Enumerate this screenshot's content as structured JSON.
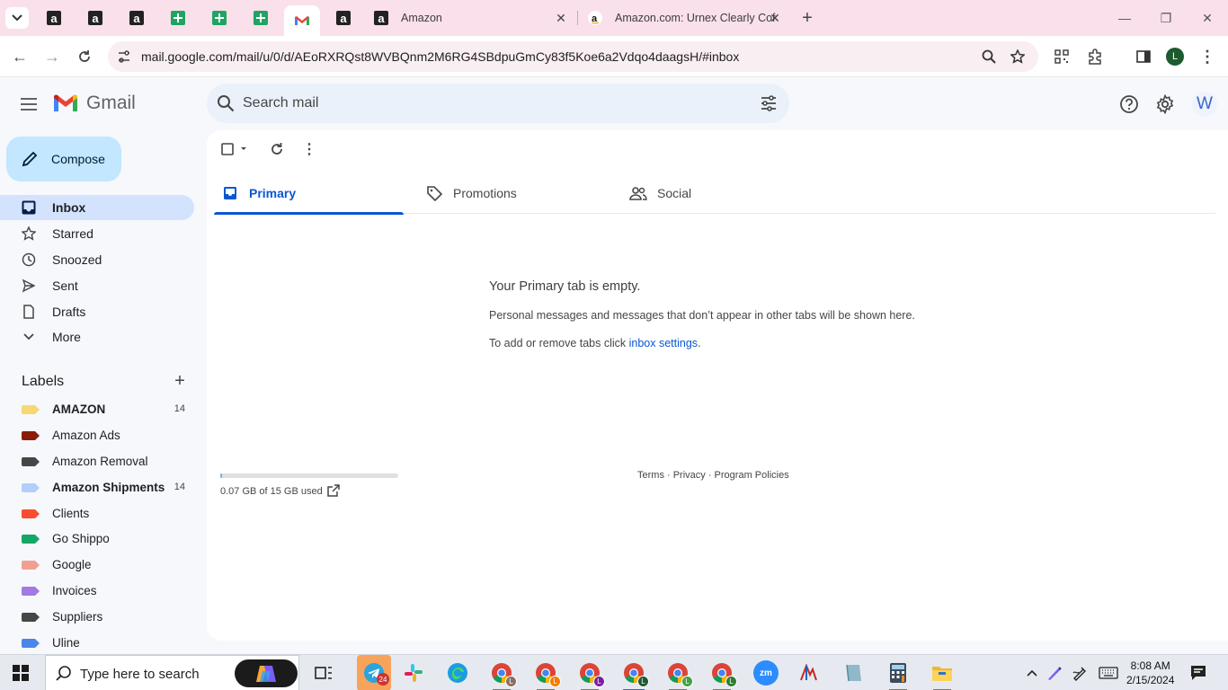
{
  "browser": {
    "tabs": [
      {
        "label": "Amazon"
      },
      {
        "label": "Amazon.com: Urnex Clearly Cof"
      }
    ],
    "url": "mail.google.com/mail/u/0/d/AEoRXRQst8WVBQnm2M6RG4SBdpuGmCy83f5Koe6a2Vdqo4daagsH/#inbox",
    "profile_initial": "L"
  },
  "header": {
    "logo_text": "Gmail",
    "search_placeholder": "Search mail",
    "avatar_initial": "W"
  },
  "sidebar": {
    "compose_label": "Compose",
    "items": [
      {
        "label": "Inbox",
        "icon": "inbox-icon",
        "active": true
      },
      {
        "label": "Starred",
        "icon": "star-icon"
      },
      {
        "label": "Snoozed",
        "icon": "clock-icon"
      },
      {
        "label": "Sent",
        "icon": "send-icon"
      },
      {
        "label": "Drafts",
        "icon": "draft-icon"
      },
      {
        "label": "More",
        "icon": "chevron-down-icon"
      }
    ],
    "labels_heading": "Labels",
    "labels": [
      {
        "label": "AMAZON",
        "count": "14",
        "color": "#f8d775",
        "bold": true
      },
      {
        "label": "Amazon Ads",
        "count": "",
        "color": "#8a1c0a"
      },
      {
        "label": "Amazon Removal",
        "count": "",
        "color": "#444746"
      },
      {
        "label": "Amazon Shipments",
        "count": "14",
        "color": "#b3cefb",
        "bold": true
      },
      {
        "label": "Clients",
        "count": "",
        "color": "#fb4c2f"
      },
      {
        "label": "Go Shippo",
        "count": "",
        "color": "#16a766"
      },
      {
        "label": "Google",
        "count": "",
        "color": "#efa093"
      },
      {
        "label": "Invoices",
        "count": "",
        "color": "#a479e2"
      },
      {
        "label": "Suppliers",
        "count": "",
        "color": "#444746"
      },
      {
        "label": "Uline",
        "count": "",
        "color": "#4a86e8"
      }
    ]
  },
  "main": {
    "category_tabs": [
      {
        "label": "Primary",
        "active": true
      },
      {
        "label": "Promotions"
      },
      {
        "label": "Social"
      }
    ],
    "empty_title": "Your Primary tab is empty.",
    "empty_description": "Personal messages and messages that don’t appear in other tabs will be shown here.",
    "hint_prefix": "To add or remove tabs click ",
    "hint_link": "inbox settings",
    "hint_suffix": ".",
    "storage_text": "0.07 GB of 15 GB used",
    "storage_fraction": 0.005,
    "footer": "Terms · Privacy · Program Policies"
  },
  "taskbar": {
    "search_placeholder": "Type here to search",
    "telegram_badge": "24",
    "time": "8:08 AM",
    "date": "2/15/2024"
  }
}
